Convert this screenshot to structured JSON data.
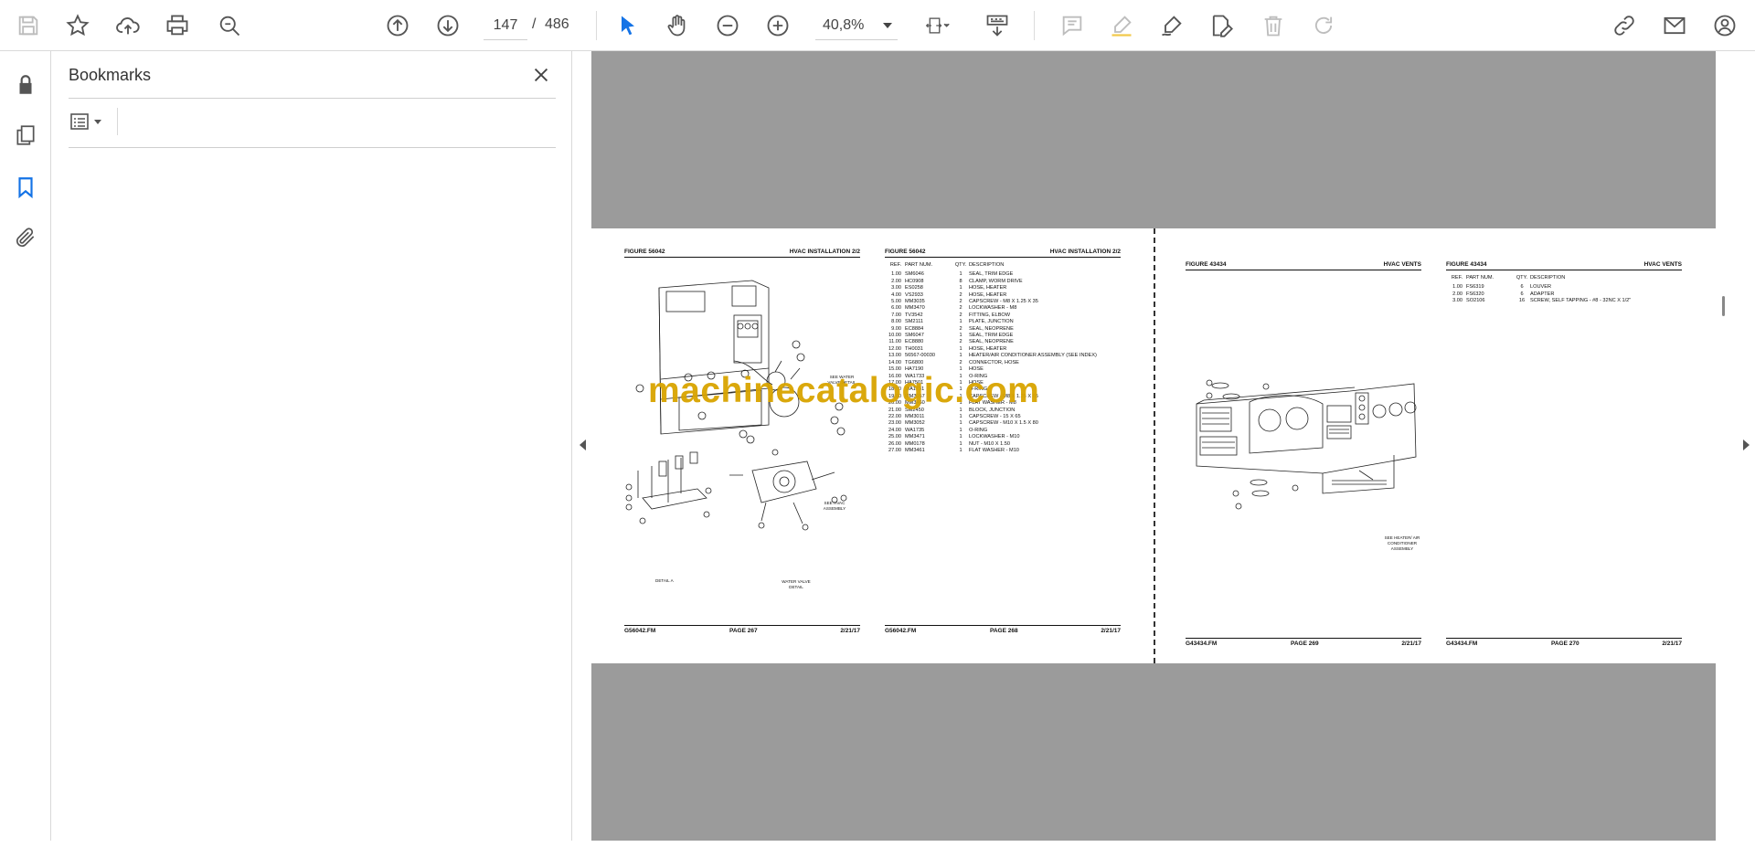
{
  "toolbar": {
    "current_page": "147",
    "page_separator": "/",
    "total_pages": "486",
    "zoom": "40,8%"
  },
  "panel": {
    "title": "Bookmarks"
  },
  "pages": {
    "p267": {
      "figure": "FIGURE 56042",
      "title": "HVAC INSTALLATION   2/2",
      "footer_file": "G56042.FM",
      "footer_page": "PAGE 267",
      "footer_date": "2/21/17",
      "callouts": [
        "SEE WATER VALVE DETAIL",
        "SEE HVAC ASSEMBLY",
        "DETAIL A",
        "WATER VALVE DETAIL"
      ]
    },
    "p268": {
      "figure": "FIGURE 56042",
      "title": "HVAC INSTALLATION   2/2",
      "columns": [
        "REF.",
        "PART NUM.",
        "QTY.",
        "DESCRIPTION"
      ],
      "rows": [
        [
          "1.00",
          "SM6046",
          "1",
          "SEAL, TRIM EDGE"
        ],
        [
          "2.00",
          "HC0908",
          "8",
          "CLAMP, WORM DRIVE"
        ],
        [
          "3.00",
          "ES0258",
          "1",
          "HOSE, HEATER"
        ],
        [
          "4.00",
          "VS2933",
          "2",
          "HOSE, HEATER"
        ],
        [
          "5.00",
          "MM3035",
          "2",
          "CAPSCREW - M8 X 1.25 X 35"
        ],
        [
          "6.00",
          "MM3470",
          "2",
          "LOCKWASHER - M8"
        ],
        [
          "7.00",
          "TV3542",
          "2",
          "FITTING, ELBOW"
        ],
        [
          "8.00",
          "SM2111",
          "1",
          "PLATE, JUNCTION"
        ],
        [
          "9.00",
          "EC8884",
          "2",
          "SEAL, NEOPRENE"
        ],
        [
          "10.00",
          "SM6047",
          "1",
          "SEAL, TRIM EDGE"
        ],
        [
          "11.00",
          "EC8880",
          "2",
          "SEAL, NEOPRENE"
        ],
        [
          "12.00",
          "TH0031",
          "1",
          "HOSE, HEATER"
        ],
        [
          "13.00",
          "56567-00030",
          "1",
          "HEATER/AIR CONDITIONER ASSEMBLY (SEE INDEX)"
        ],
        [
          "14.00",
          "TG6800",
          "2",
          "CONNECTOR, HOSE"
        ],
        [
          "15.00",
          "HA7190",
          "1",
          "HOSE"
        ],
        [
          "16.00",
          "WA1733",
          "1",
          "O-RING"
        ],
        [
          "17.00",
          "HA7501",
          "1",
          "HOSE"
        ],
        [
          "18.00",
          "WA1731",
          "1",
          "O-RING"
        ],
        [
          "19.00",
          "MM3057",
          "1",
          "CAPSCREW - M8 X 1.25 X 65"
        ],
        [
          "20.00",
          "MM3460",
          "1",
          "FLAT WASHER - M8"
        ],
        [
          "21.00",
          "SM2450",
          "1",
          "BLOCK, JUNCTION"
        ],
        [
          "22.00",
          "MM3011",
          "1",
          "CAPSCREW - 15 X 65"
        ],
        [
          "23.00",
          "MM3052",
          "1",
          "CAPSCREW - M10 X 1.5 X 80"
        ],
        [
          "24.00",
          "WA1735",
          "1",
          "O-RING"
        ],
        [
          "25.00",
          "MM3471",
          "1",
          "LOCKWASHER - M10"
        ],
        [
          "26.00",
          "MM0178",
          "1",
          "NUT - M10 X 1.50"
        ],
        [
          "27.00",
          "MM3461",
          "1",
          "FLAT WASHER - M10"
        ]
      ],
      "footer_file": "G56042.FM",
      "footer_page": "PAGE 268",
      "footer_date": "2/21/17"
    },
    "p269": {
      "figure": "FIGURE 43434",
      "title": "HVAC VENTS",
      "callouts": [
        "SEE HEATER/ AIR CONDITIONER ASSEMBLY"
      ],
      "footer_file": "G43434.FM",
      "footer_page": "PAGE 269",
      "footer_date": "2/21/17"
    },
    "p270": {
      "figure": "FIGURE 43434",
      "title": "HVAC VENTS",
      "columns": [
        "REF.",
        "PART NUM.",
        "QTY.",
        "DESCRIPTION"
      ],
      "rows": [
        [
          "1.00",
          "FS6319",
          "6",
          "LOUVER"
        ],
        [
          "2.00",
          "FS6320",
          "6",
          "ADAPTER"
        ],
        [
          "3.00",
          "SO2106",
          "16",
          "SCREW, SELF TAPPING - #8 - 32NC X 1/2\""
        ]
      ],
      "footer_file": "G43434.FM",
      "footer_page": "PAGE 270",
      "footer_date": "2/21/17"
    }
  },
  "watermark": "machinecatalogic.com",
  "icons": {
    "save": "save-icon",
    "star": "star-icon",
    "upload": "upload-icon",
    "print": "print-icon",
    "zoom_search": "zoom-search-icon",
    "prev": "arrow-up-circle-icon",
    "next": "arrow-down-circle-icon",
    "select": "cursor-icon",
    "hand": "hand-icon",
    "zoom_out": "minus-circle-icon",
    "zoom_in": "plus-circle-icon",
    "fit": "fit-page-icon",
    "scroll_mode": "scroll-mode-icon",
    "comment": "comment-icon",
    "highlight": "highlight-icon",
    "sign": "sign-icon",
    "edit": "edit-icon",
    "delete": "trash-icon",
    "redo": "redo-icon",
    "link": "link-icon",
    "mail": "mail-icon",
    "account": "account-icon"
  },
  "colors": {
    "accent": "#1473e6",
    "canvas": "#9b9b9b",
    "watermark": "#d9a400"
  }
}
